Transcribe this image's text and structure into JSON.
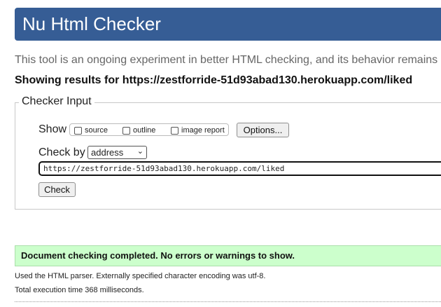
{
  "header": {
    "title": "Nu Html Checker"
  },
  "intro": {
    "text": "This tool is an ongoing experiment in better HTML checking, and its behavior remains"
  },
  "results": {
    "heading": "Showing results for https://zestforride-51d93abad130.herokuapp.com/liked"
  },
  "checker_input": {
    "legend": "Checker Input",
    "show_label": "Show",
    "show_options": [
      {
        "label": "source",
        "checked": false
      },
      {
        "label": "outline",
        "checked": false
      },
      {
        "label": "image report",
        "checked": false
      }
    ],
    "options_button": "Options...",
    "check_by_label": "Check by",
    "check_by_value": "address",
    "url_value": "https://zestforride-51d93abad130.herokuapp.com/liked",
    "check_button": "Check"
  },
  "outcome": {
    "message": "Document checking completed. No errors or warnings to show.",
    "color_success_bg": "#ccffcc"
  },
  "notes": {
    "parser": "Used the HTML parser. Externally specified character encoding was utf-8.",
    "time": "Total execution time 368 milliseconds."
  },
  "colors": {
    "banner": "#365d95"
  }
}
